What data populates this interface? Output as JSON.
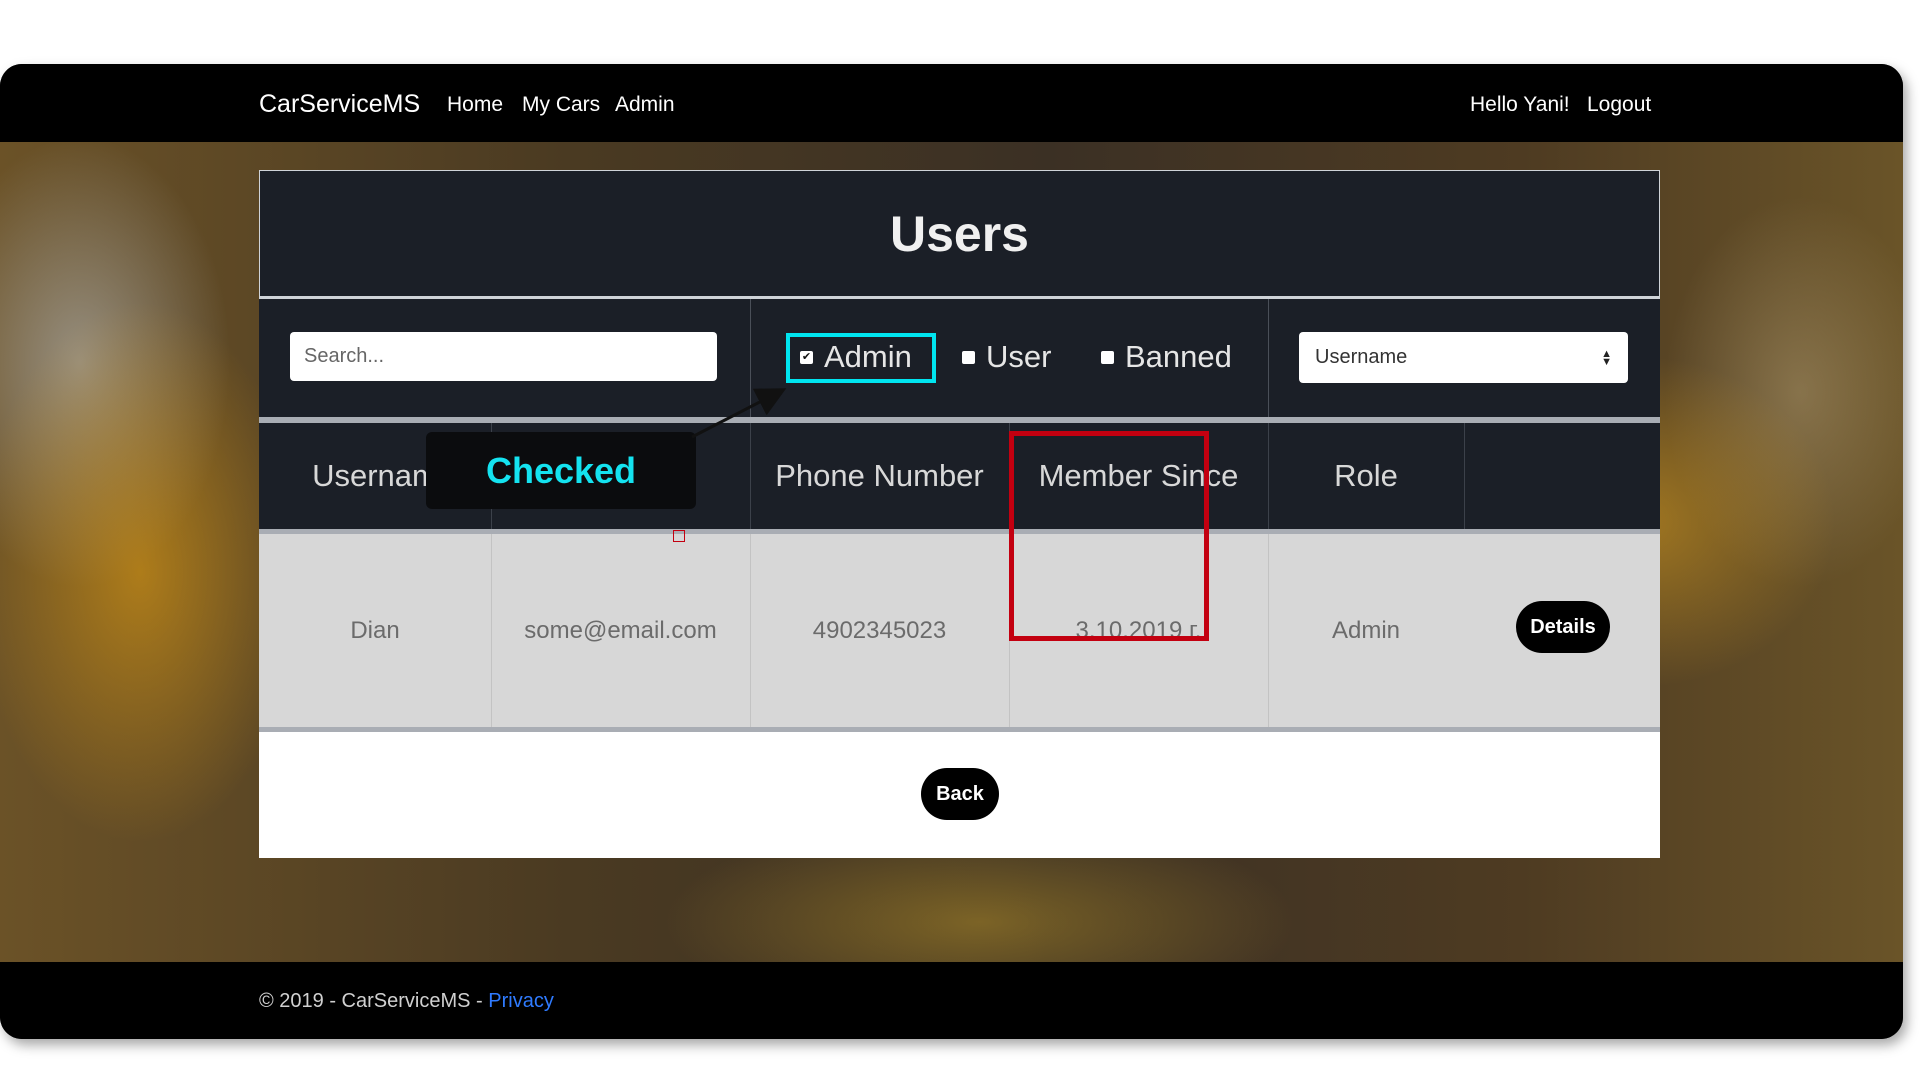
{
  "navbar": {
    "brand": "CarServiceMS",
    "links": [
      "Home",
      "My Cars",
      "Admin"
    ],
    "greeting": "Hello Yani!",
    "logout": "Logout"
  },
  "panel": {
    "title": "Users",
    "search_placeholder": "Search...",
    "filters": [
      {
        "label": "Admin",
        "checked": true
      },
      {
        "label": "User",
        "checked": false
      },
      {
        "label": "Banned",
        "checked": false
      }
    ],
    "sort_select": "Username"
  },
  "table": {
    "headers": [
      "Usernam",
      "",
      "Phone Number",
      "Member Since",
      "Role",
      ""
    ],
    "rows": [
      {
        "username": "Dian",
        "email": "some@email.com",
        "phone": "4902345023",
        "member_since": "3.10.2019 г.",
        "role": "Admin",
        "action": "Details"
      }
    ]
  },
  "back_label": "Back",
  "annotation": {
    "tooltip": "Checked",
    "highlight_color": "#00e5f0",
    "row_highlight_color": "#c30010"
  },
  "footer": {
    "text": "© 2019 - CarServiceMS - ",
    "privacy": "Privacy"
  }
}
